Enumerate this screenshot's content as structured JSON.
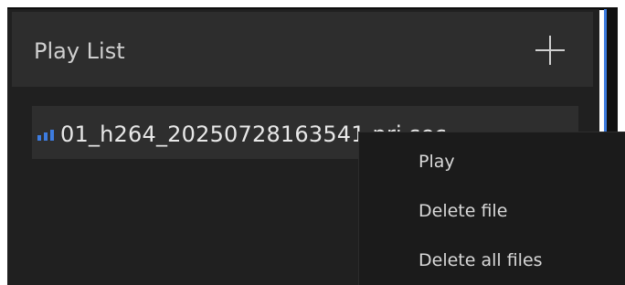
{
  "playlist": {
    "title": "Play List",
    "add_icon": "plus-icon",
    "items": [
      {
        "name": "01_h264_20250728163541.pri.sec",
        "icon": "signal-bars-icon"
      }
    ]
  },
  "context_menu": {
    "items": [
      {
        "label": "Play"
      },
      {
        "label": "Delete file"
      },
      {
        "label": "Delete all files"
      }
    ]
  },
  "colors": {
    "panel_bg": "#202020",
    "header_bg": "#2d2d2d",
    "row_bg": "#2e2e2e",
    "menu_bg": "#1b1b1b",
    "accent": "#3d7ce0"
  }
}
